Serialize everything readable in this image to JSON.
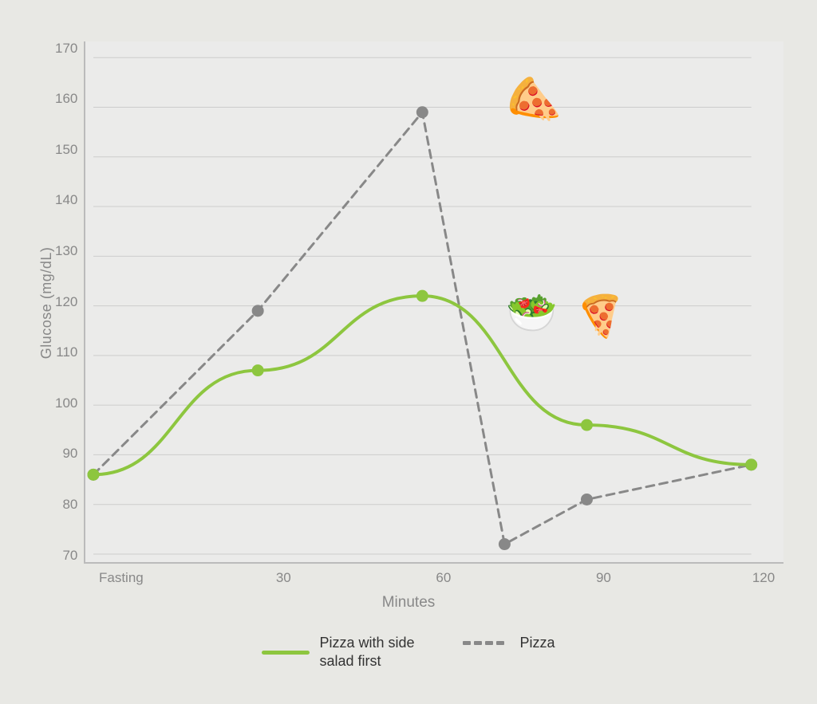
{
  "chart": {
    "title": "Glucose (mg/dL)",
    "x_label": "Minutes",
    "y_axis": {
      "ticks": [
        "170",
        "160",
        "150",
        "140",
        "130",
        "120",
        "110",
        "100",
        "90",
        "80",
        "70"
      ]
    },
    "x_axis": {
      "ticks": [
        "Fasting",
        "30",
        "60",
        "90",
        "120"
      ]
    },
    "series": {
      "solid": {
        "name": "Pizza with side salad first",
        "color": "#8dc63f",
        "points": [
          {
            "x": 0,
            "y": 86
          },
          {
            "x": 30,
            "y": 107
          },
          {
            "x": 60,
            "y": 122
          },
          {
            "x": 90,
            "y": 96
          },
          {
            "x": 120,
            "y": 88
          }
        ]
      },
      "dashed": {
        "name": "Pizza",
        "color": "#888888",
        "points": [
          {
            "x": 0,
            "y": 86
          },
          {
            "x": 30,
            "y": 119
          },
          {
            "x": 60,
            "y": 159
          },
          {
            "x": 75,
            "y": 72
          },
          {
            "x": 90,
            "y": 81
          },
          {
            "x": 120,
            "y": 88
          }
        ]
      }
    },
    "emojis": [
      {
        "label": "pizza-top",
        "emoji": "🍕",
        "x_frac": 0.67,
        "y_frac": 0.12,
        "size": 60
      },
      {
        "label": "salad",
        "emoji": "🥗",
        "x_frac": 0.67,
        "y_frac": 0.44,
        "size": 54
      },
      {
        "label": "pizza-bottom",
        "emoji": "🍕",
        "x_frac": 0.76,
        "y_frac": 0.44,
        "size": 52
      }
    ]
  },
  "legend": {
    "solid_label": "Pizza with side\nsalad first",
    "dashed_label": "Pizza"
  }
}
